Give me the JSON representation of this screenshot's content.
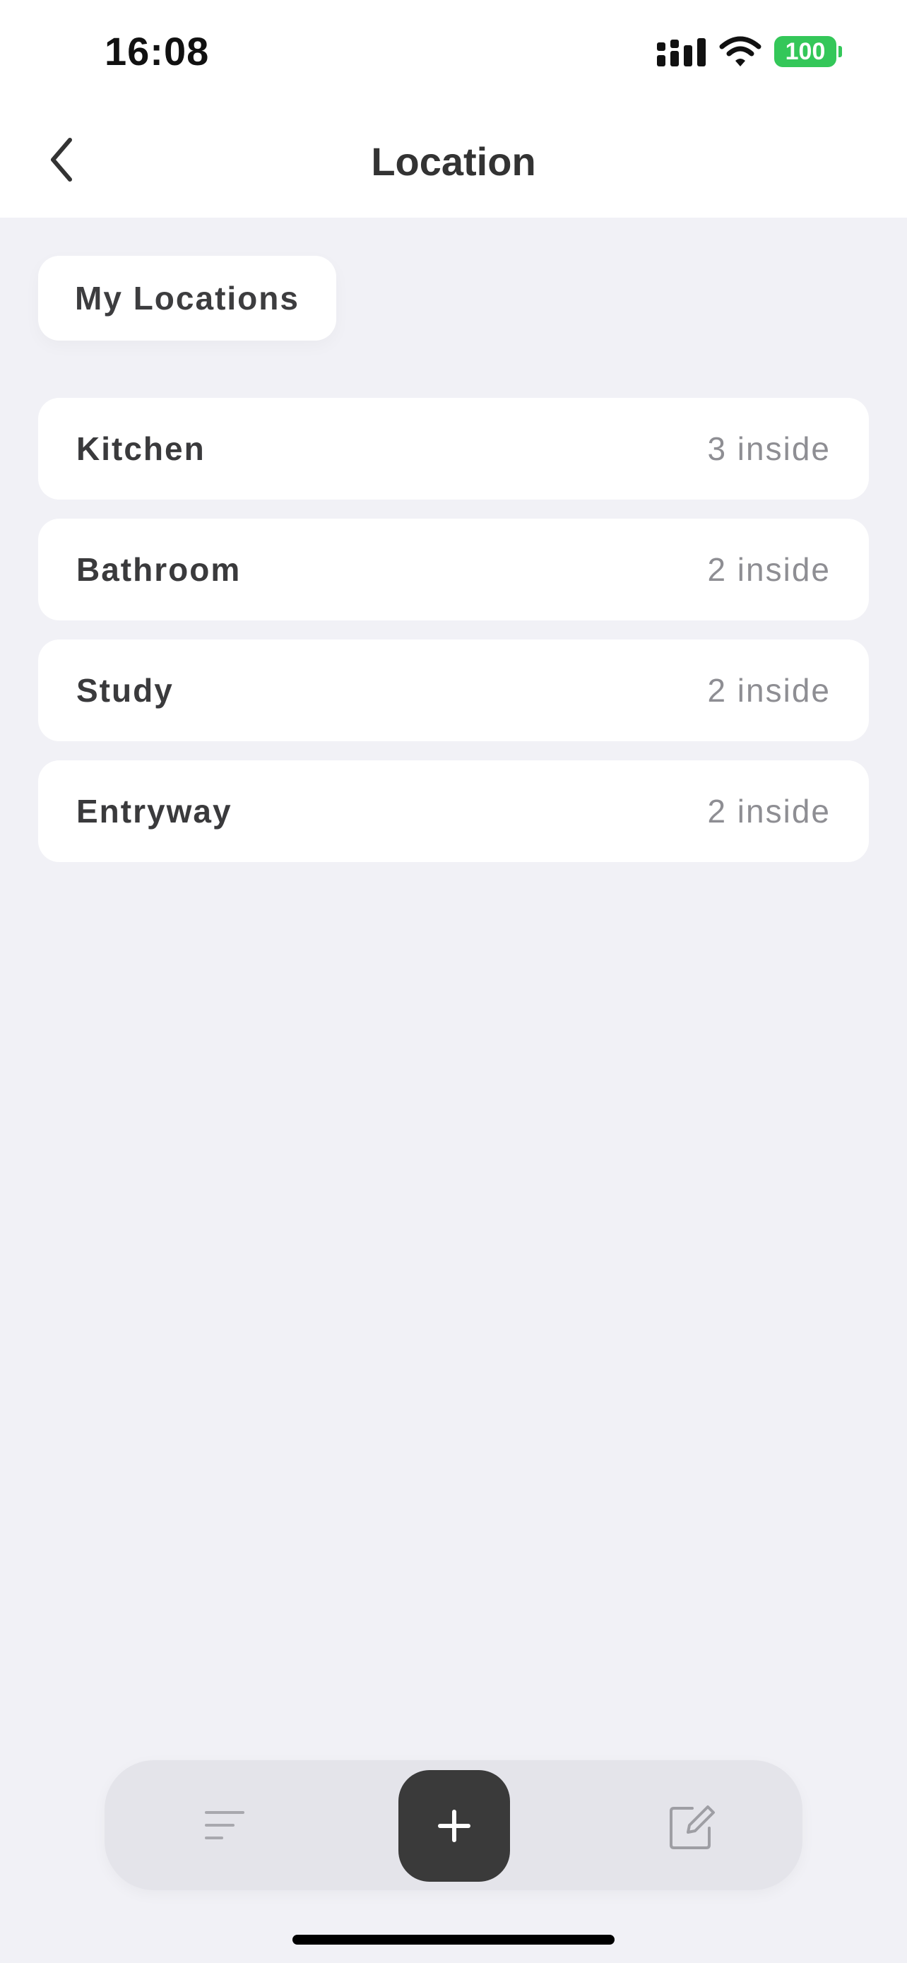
{
  "status_bar": {
    "time": "16:08",
    "battery": "100"
  },
  "nav": {
    "title": "Location",
    "back_icon": "chevron-left-icon"
  },
  "section_chip": "My Locations",
  "locations": [
    {
      "name": "Kitchen",
      "count": "3 inside"
    },
    {
      "name": "Bathroom",
      "count": "2 inside"
    },
    {
      "name": "Study",
      "count": "2 inside"
    },
    {
      "name": "Entryway",
      "count": "2 inside"
    }
  ],
  "toolbar": {
    "sort_icon": "sort-lines-icon",
    "add_icon": "plus-icon",
    "edit_icon": "edit-square-icon"
  },
  "colors": {
    "background": "#F1F1F6",
    "card": "#FFFFFF",
    "battery": "#34C759",
    "fab": "#3A3A3A"
  }
}
